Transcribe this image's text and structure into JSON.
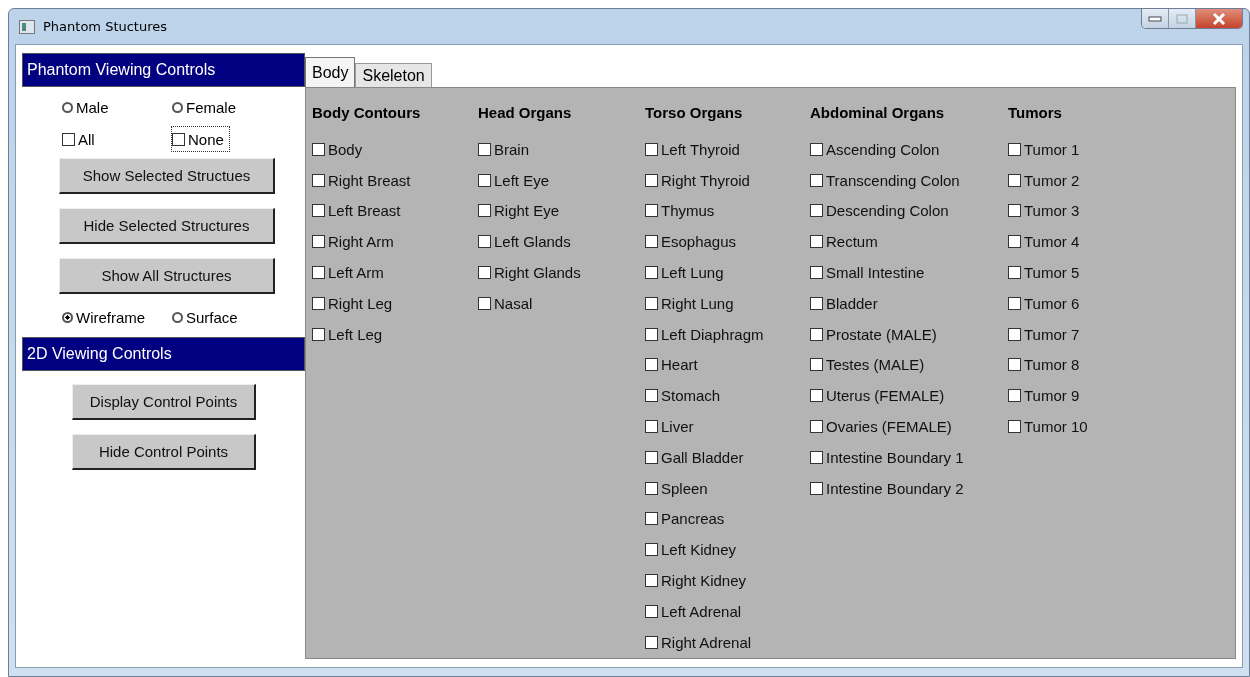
{
  "window": {
    "title": "Phantom Stuctures"
  },
  "viewing_controls": {
    "title": "Phantom Viewing Controls",
    "sex_options": [
      {
        "label": "Male",
        "selected": false
      },
      {
        "label": "Female",
        "selected": false
      }
    ],
    "select_options": [
      {
        "label": "All",
        "checked": false
      },
      {
        "label": "None",
        "checked": false
      }
    ],
    "buttons": [
      "Show Selected Structues",
      "Hide Selected Structures",
      "Show All Structures"
    ],
    "render_modes": [
      {
        "label": "Wireframe",
        "selected": true
      },
      {
        "label": "Surface",
        "selected": false
      }
    ]
  },
  "controls_2d": {
    "title": "2D Viewing Controls",
    "buttons": [
      "Display Control Points",
      "Hide Control Points"
    ]
  },
  "tabs": [
    {
      "label": "Body",
      "selected": true
    },
    {
      "label": "Skeleton",
      "selected": false
    }
  ],
  "groups": [
    {
      "title": "Body Contours",
      "items": [
        {
          "label": "Body",
          "checked": false
        },
        {
          "label": "Right Breast",
          "checked": false
        },
        {
          "label": "Left Breast",
          "checked": false
        },
        {
          "label": "Right Arm",
          "checked": false
        },
        {
          "label": "Left Arm",
          "checked": false
        },
        {
          "label": "Right Leg",
          "checked": false
        },
        {
          "label": "Left Leg",
          "checked": false
        }
      ]
    },
    {
      "title": "Head Organs",
      "items": [
        {
          "label": "Brain",
          "checked": false
        },
        {
          "label": "Left Eye",
          "checked": false
        },
        {
          "label": "Right Eye",
          "checked": false
        },
        {
          "label": "Left Glands",
          "checked": false
        },
        {
          "label": "Right Glands",
          "checked": false
        },
        {
          "label": "Nasal",
          "checked": false
        }
      ]
    },
    {
      "title": "Torso Organs",
      "items": [
        {
          "label": "Left Thyroid",
          "checked": false
        },
        {
          "label": "Right Thyroid",
          "checked": false
        },
        {
          "label": "Thymus",
          "checked": false
        },
        {
          "label": "Esophagus",
          "checked": false
        },
        {
          "label": "Left Lung",
          "checked": false
        },
        {
          "label": "Right Lung",
          "checked": false
        },
        {
          "label": "Left Diaphragm",
          "checked": false
        },
        {
          "label": "Heart",
          "checked": false
        },
        {
          "label": "Stomach",
          "checked": false
        },
        {
          "label": "Liver",
          "checked": false
        },
        {
          "label": "Gall Bladder",
          "checked": false
        },
        {
          "label": "Spleen",
          "checked": false
        },
        {
          "label": "Pancreas",
          "checked": false
        },
        {
          "label": "Left Kidney",
          "checked": false
        },
        {
          "label": "Right Kidney",
          "checked": false
        },
        {
          "label": "Left Adrenal",
          "checked": false
        },
        {
          "label": "Right Adrenal",
          "checked": false
        }
      ]
    },
    {
      "title": "Abdominal Organs",
      "items": [
        {
          "label": "Ascending Colon",
          "checked": false
        },
        {
          "label": "Transcending Colon",
          "checked": false
        },
        {
          "label": "Descending Colon",
          "checked": false
        },
        {
          "label": "Rectum",
          "checked": false
        },
        {
          "label": "Small Intestine",
          "checked": false
        },
        {
          "label": "Bladder",
          "checked": false
        },
        {
          "label": "Prostate (MALE)",
          "checked": false
        },
        {
          "label": "Testes (MALE)",
          "checked": false
        },
        {
          "label": "Uterus (FEMALE)",
          "checked": false
        },
        {
          "label": "Ovaries (FEMALE)",
          "checked": false
        },
        {
          "label": "Intestine Boundary 1",
          "checked": false
        },
        {
          "label": "Intestine Boundary 2",
          "checked": false
        }
      ]
    },
    {
      "title": "Tumors",
      "items": [
        {
          "label": "Tumor 1",
          "checked": false
        },
        {
          "label": "Tumor 2",
          "checked": false
        },
        {
          "label": "Tumor 3",
          "checked": false
        },
        {
          "label": "Tumor 4",
          "checked": false
        },
        {
          "label": "Tumor 5",
          "checked": false
        },
        {
          "label": "Tumor 6",
          "checked": false
        },
        {
          "label": "Tumor 7",
          "checked": false
        },
        {
          "label": "Tumor 8",
          "checked": false
        },
        {
          "label": "Tumor 9",
          "checked": false
        },
        {
          "label": "Tumor 10",
          "checked": false
        }
      ]
    }
  ]
}
